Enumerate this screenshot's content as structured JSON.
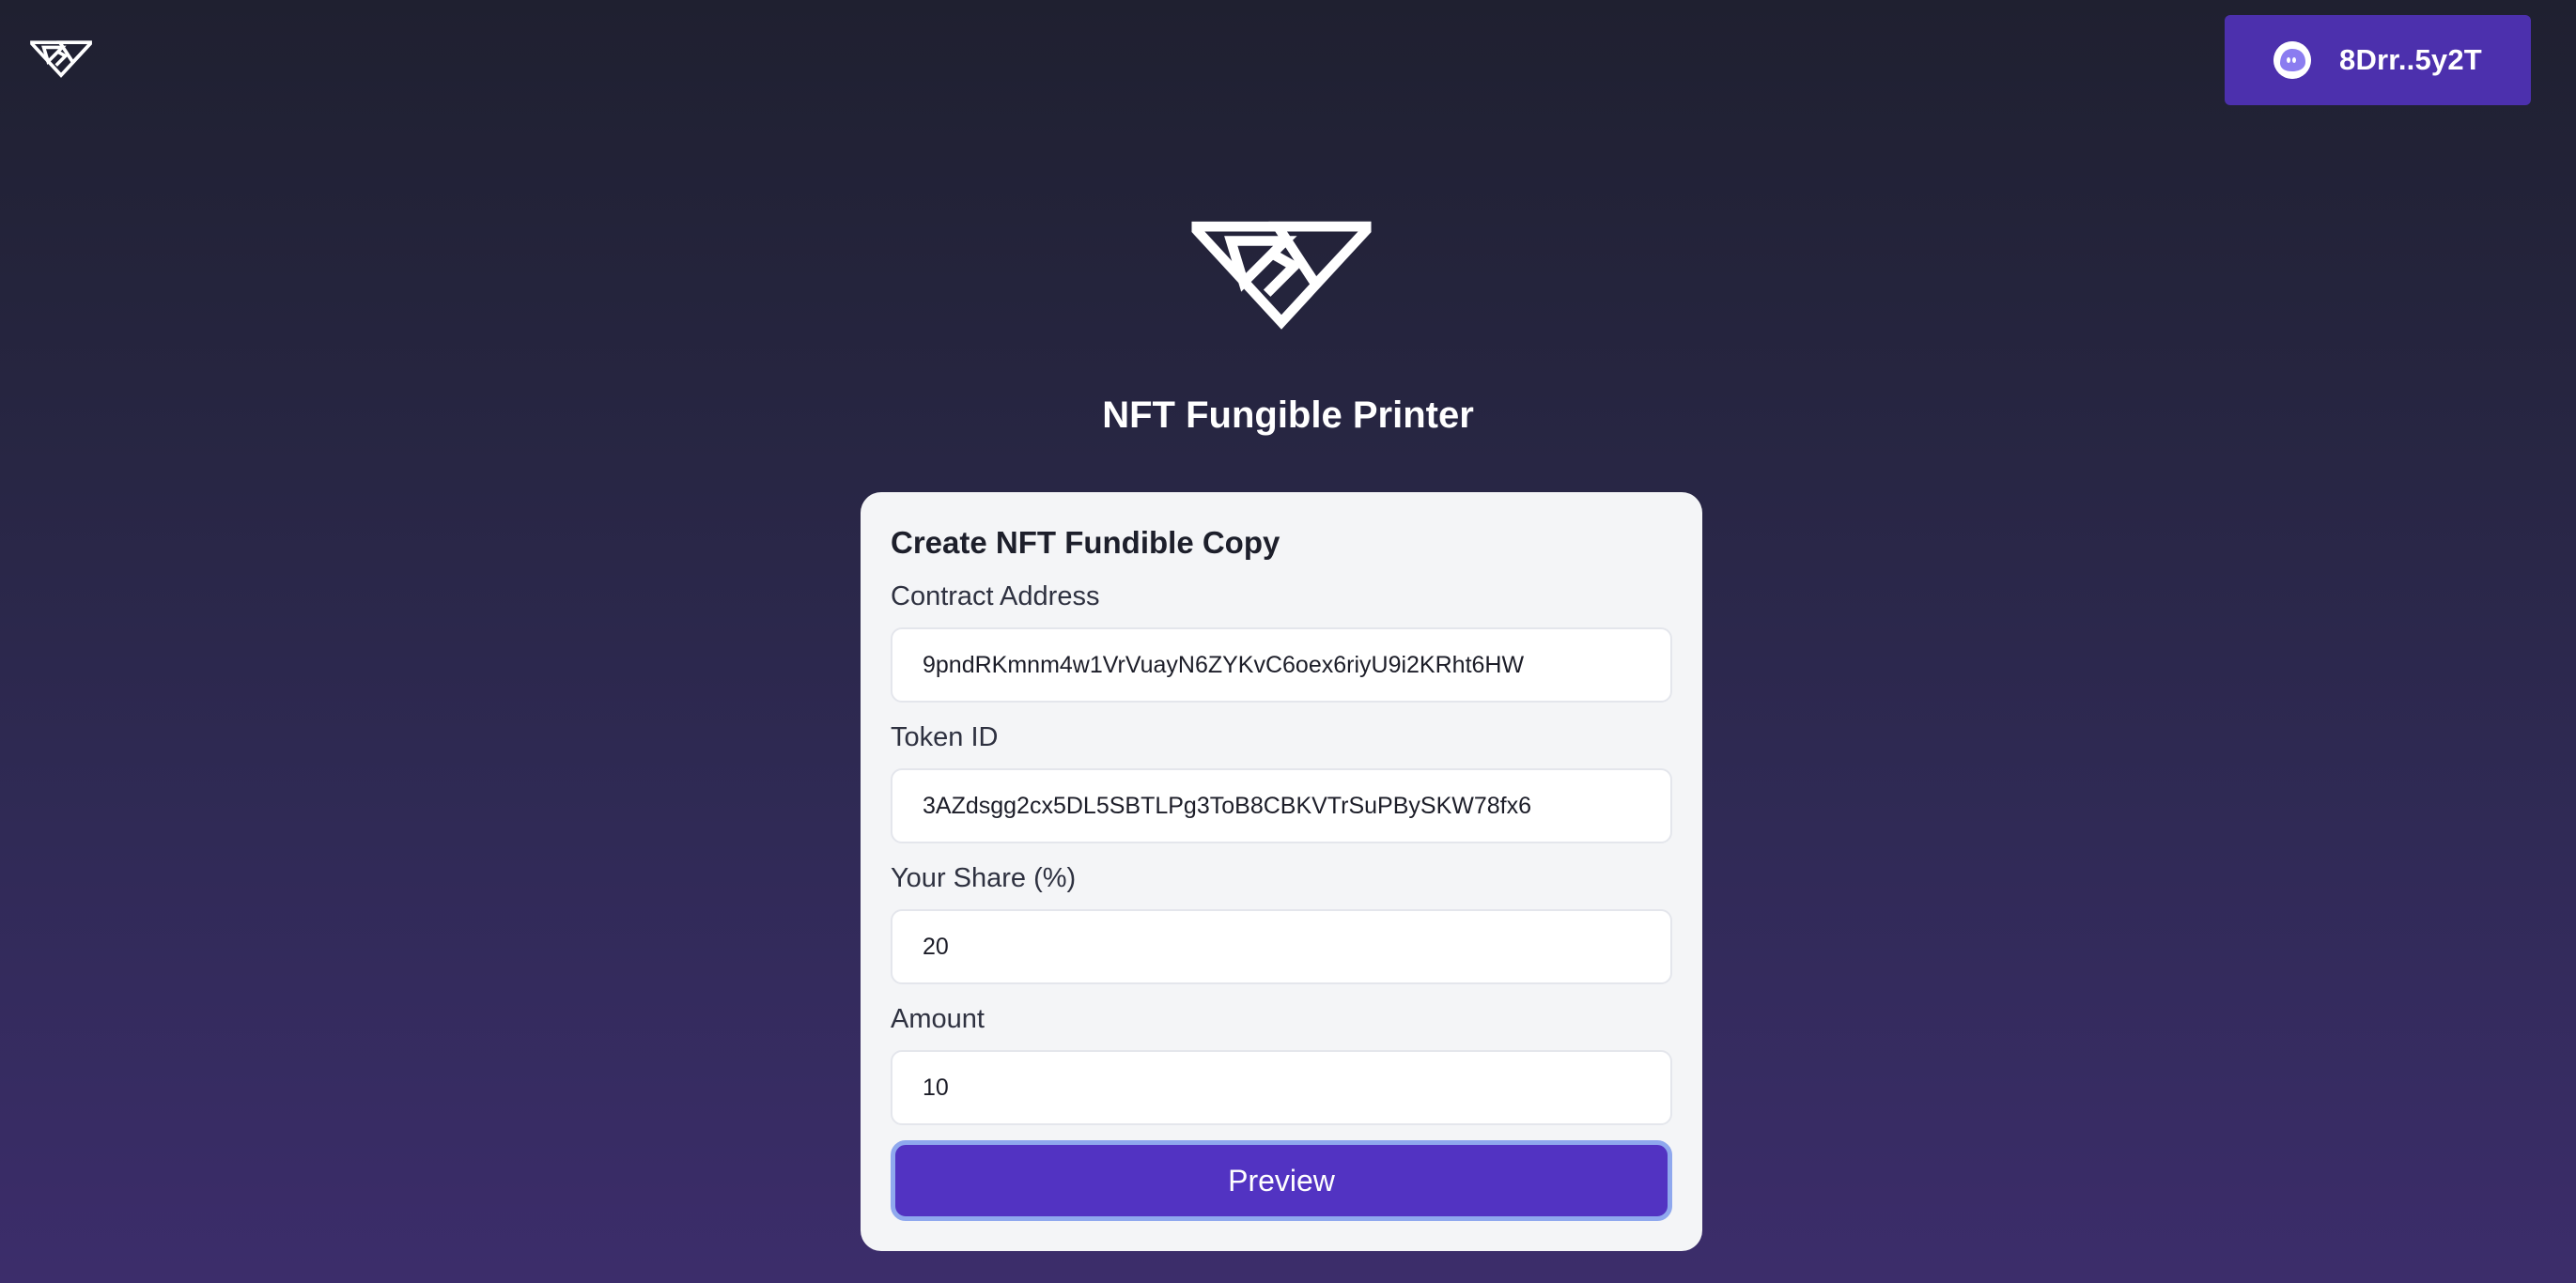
{
  "header": {
    "logo_icon": "diamond-logo-icon",
    "wallet": {
      "icon": "ghost-icon",
      "address_label": "8Drr..5y2T"
    }
  },
  "hero": {
    "logo_icon": "diamond-logo-icon",
    "title": "NFT Fungible Printer"
  },
  "form": {
    "title": "Create NFT Fundible Copy",
    "fields": [
      {
        "label": "Contract Address",
        "value": "9pndRKmnm4w1VrVuayN6ZYKvC6oex6riyU9i2KRht6HW"
      },
      {
        "label": "Token ID",
        "value": "3AZdsgg2cx5DL5SBTLPg3ToB8CBKVTrSuPBySKW78fx6"
      },
      {
        "label": "Your Share (%)",
        "value": "20"
      },
      {
        "label": "Amount",
        "value": "10"
      }
    ],
    "submit_label": "Preview"
  },
  "colors": {
    "wallet_button": "#4c30ad",
    "primary_button": "#5233c2",
    "primary_button_focus_ring": "#8fa8ee",
    "card_background": "#f4f5f7",
    "page_gradient_top": "#1f2030",
    "page_gradient_bottom": "#3c2d6b"
  }
}
